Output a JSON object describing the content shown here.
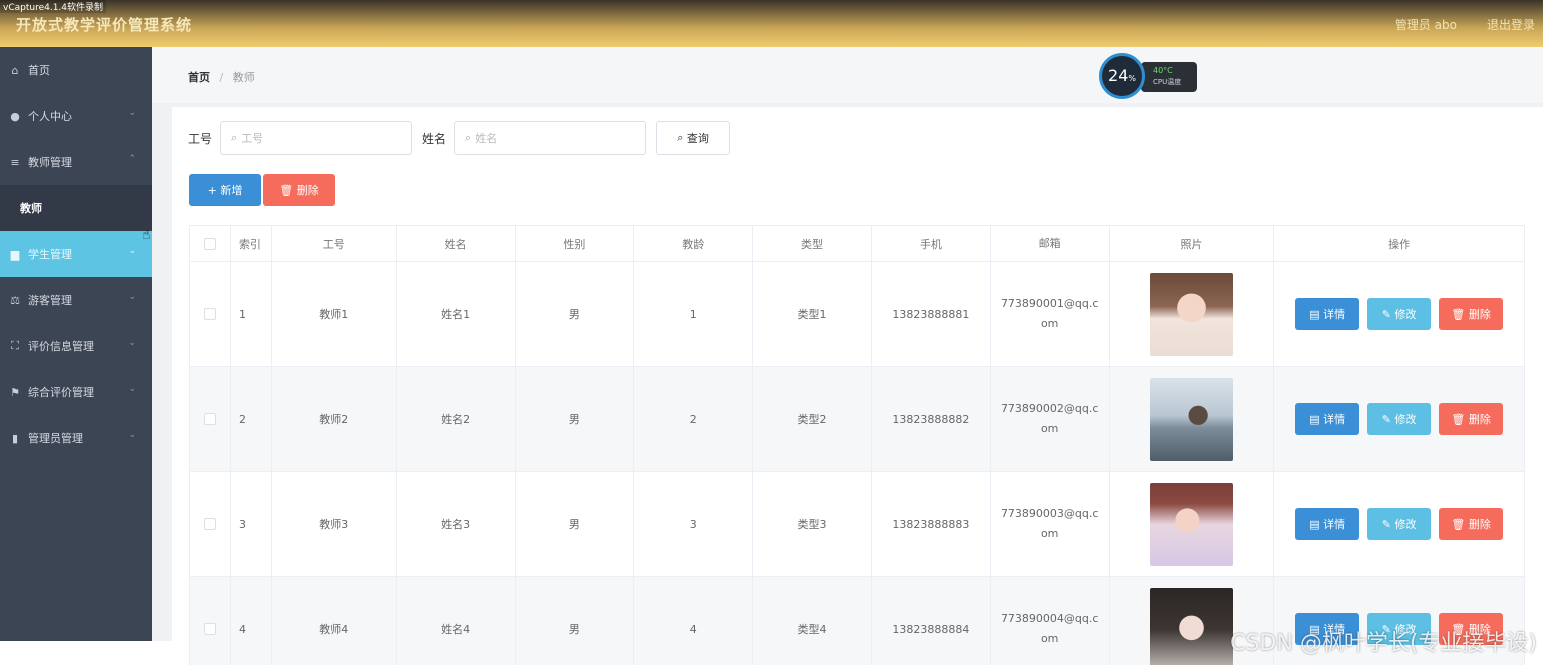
{
  "recorder": "vCapture4.1.4软件录制",
  "header": {
    "title": "开放式教学评价管理系统",
    "admin": "管理员 abo",
    "logout": "退出登录"
  },
  "sidebar": {
    "items": [
      {
        "label": "首页",
        "icon": "home-icon",
        "glyph": "⌂",
        "chev": ""
      },
      {
        "label": "个人中心",
        "icon": "user-icon",
        "glyph": "●",
        "chev": "⌄"
      },
      {
        "label": "教师管理",
        "icon": "list-icon",
        "glyph": "≡",
        "chev": "⌃"
      },
      {
        "label": "教师",
        "icon": "",
        "glyph": "",
        "chev": ""
      },
      {
        "label": "学生管理",
        "icon": "folder-icon",
        "glyph": "▆",
        "chev": "⌄"
      },
      {
        "label": "游客管理",
        "icon": "scale-icon",
        "glyph": "⚖",
        "chev": "⌄"
      },
      {
        "label": "评价信息管理",
        "icon": "frame-icon",
        "glyph": "⛶",
        "chev": "⌄"
      },
      {
        "label": "综合评价管理",
        "icon": "flag-icon",
        "glyph": "⚑",
        "chev": "⌄"
      },
      {
        "label": "管理员管理",
        "icon": "bar-chart-icon",
        "glyph": "▮",
        "chev": "⌄"
      }
    ]
  },
  "breadcrumb": {
    "home": "首页",
    "sep": "/",
    "current": "教师"
  },
  "cpu_widget": {
    "usage": "24",
    "unit": "%",
    "temp": "40°C",
    "label": "CPU温度"
  },
  "search": {
    "label_no": "工号",
    "placeholder_no": "工号",
    "label_name": "姓名",
    "placeholder_name": "姓名",
    "button": "查询"
  },
  "actions": {
    "add": "新增",
    "delete": "删除"
  },
  "table": {
    "headers": [
      "索引",
      "工号",
      "姓名",
      "性别",
      "教龄",
      "类型",
      "手机",
      "邮箱",
      "照片",
      "操作"
    ],
    "rows": [
      {
        "idx": "1",
        "no": "教师1",
        "name": "姓名1",
        "sex": "男",
        "age": "1",
        "type": "类型1",
        "phone": "13823888881",
        "email": "773890001@qq.com",
        "detail": "详情",
        "edit": "修改",
        "remove": "删除"
      },
      {
        "idx": "2",
        "no": "教师2",
        "name": "姓名2",
        "sex": "男",
        "age": "2",
        "type": "类型2",
        "phone": "13823888882",
        "email": "773890002@qq.com",
        "detail": "详情",
        "edit": "修改",
        "remove": "删除"
      },
      {
        "idx": "3",
        "no": "教师3",
        "name": "姓名3",
        "sex": "男",
        "age": "3",
        "type": "类型3",
        "phone": "13823888883",
        "email": "773890003@qq.com",
        "detail": "详情",
        "edit": "修改",
        "remove": "删除"
      },
      {
        "idx": "4",
        "no": "教师4",
        "name": "姓名4",
        "sex": "男",
        "age": "4",
        "type": "类型4",
        "phone": "13823888884",
        "email": "773890004@qq.com",
        "detail": "详情",
        "edit": "修改",
        "remove": "删除"
      }
    ]
  },
  "watermark": "CSDN @枫叶学长(专业接毕设)"
}
